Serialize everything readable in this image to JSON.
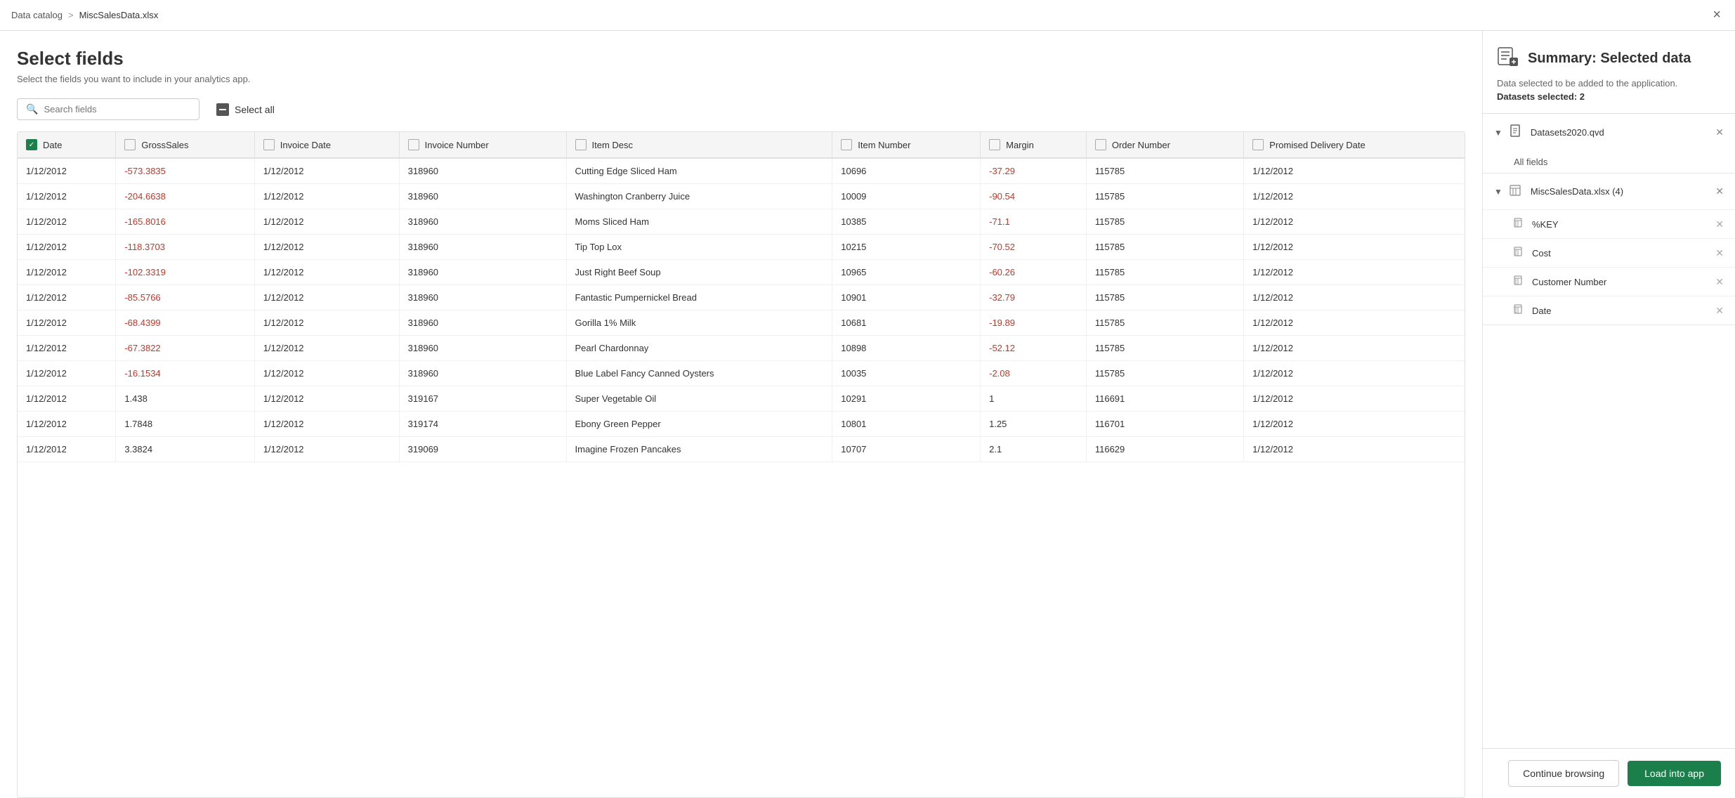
{
  "topbar": {
    "breadcrumb_catalog": "Data catalog",
    "breadcrumb_separator": ">",
    "breadcrumb_file": "MiscSalesData.xlsx",
    "close_label": "×"
  },
  "page": {
    "title": "Select fields",
    "subtitle": "Select the fields you want to include in your analytics app."
  },
  "toolbar": {
    "search_placeholder": "Search fields",
    "select_all_label": "Select all"
  },
  "table": {
    "columns": [
      {
        "id": "date",
        "label": "Date",
        "checked": true
      },
      {
        "id": "grosssales",
        "label": "GrossSales",
        "checked": false
      },
      {
        "id": "invoicedate",
        "label": "Invoice Date",
        "checked": false
      },
      {
        "id": "invoicenumber",
        "label": "Invoice Number",
        "checked": false
      },
      {
        "id": "itemdesc",
        "label": "Item Desc",
        "checked": false
      },
      {
        "id": "itemnumber",
        "label": "Item Number",
        "checked": false
      },
      {
        "id": "margin",
        "label": "Margin",
        "checked": false
      },
      {
        "id": "ordernumber",
        "label": "Order Number",
        "checked": false
      },
      {
        "id": "promiseddeliverydate",
        "label": "Promised Delivery Date",
        "checked": false
      }
    ],
    "rows": [
      {
        "date": "1/12/2012",
        "grosssales": "-573.3835",
        "invoicedate": "1/12/2012",
        "invoicenumber": "318960",
        "itemdesc": "Cutting Edge Sliced Ham",
        "itemnumber": "10696",
        "margin": "-37.29",
        "ordernumber": "115785",
        "promiseddeliverydate": "1/12/2012"
      },
      {
        "date": "1/12/2012",
        "grosssales": "-204.6638",
        "invoicedate": "1/12/2012",
        "invoicenumber": "318960",
        "itemdesc": "Washington Cranberry Juice",
        "itemnumber": "10009",
        "margin": "-90.54",
        "ordernumber": "115785",
        "promiseddeliverydate": "1/12/2012"
      },
      {
        "date": "1/12/2012",
        "grosssales": "-165.8016",
        "invoicedate": "1/12/2012",
        "invoicenumber": "318960",
        "itemdesc": "Moms Sliced Ham",
        "itemnumber": "10385",
        "margin": "-71.1",
        "ordernumber": "115785",
        "promiseddeliverydate": "1/12/2012"
      },
      {
        "date": "1/12/2012",
        "grosssales": "-118.3703",
        "invoicedate": "1/12/2012",
        "invoicenumber": "318960",
        "itemdesc": "Tip Top Lox",
        "itemnumber": "10215",
        "margin": "-70.52",
        "ordernumber": "115785",
        "promiseddeliverydate": "1/12/2012"
      },
      {
        "date": "1/12/2012",
        "grosssales": "-102.3319",
        "invoicedate": "1/12/2012",
        "invoicenumber": "318960",
        "itemdesc": "Just Right Beef Soup",
        "itemnumber": "10965",
        "margin": "-60.26",
        "ordernumber": "115785",
        "promiseddeliverydate": "1/12/2012"
      },
      {
        "date": "1/12/2012",
        "grosssales": "-85.5766",
        "invoicedate": "1/12/2012",
        "invoicenumber": "318960",
        "itemdesc": "Fantastic Pumpernickel Bread",
        "itemnumber": "10901",
        "margin": "-32.79",
        "ordernumber": "115785",
        "promiseddeliverydate": "1/12/2012"
      },
      {
        "date": "1/12/2012",
        "grosssales": "-68.4399",
        "invoicedate": "1/12/2012",
        "invoicenumber": "318960",
        "itemdesc": "Gorilla 1% Milk",
        "itemnumber": "10681",
        "margin": "-19.89",
        "ordernumber": "115785",
        "promiseddeliverydate": "1/12/2012"
      },
      {
        "date": "1/12/2012",
        "grosssales": "-67.3822",
        "invoicedate": "1/12/2012",
        "invoicenumber": "318960",
        "itemdesc": "Pearl Chardonnay",
        "itemnumber": "10898",
        "margin": "-52.12",
        "ordernumber": "115785",
        "promiseddeliverydate": "1/12/2012"
      },
      {
        "date": "1/12/2012",
        "grosssales": "-16.1534",
        "invoicedate": "1/12/2012",
        "invoicenumber": "318960",
        "itemdesc": "Blue Label Fancy Canned Oysters",
        "itemnumber": "10035",
        "margin": "-2.08",
        "ordernumber": "115785",
        "promiseddeliverydate": "1/12/2012"
      },
      {
        "date": "1/12/2012",
        "grosssales": "1.438",
        "invoicedate": "1/12/2012",
        "invoicenumber": "319167",
        "itemdesc": "Super Vegetable Oil",
        "itemnumber": "10291",
        "margin": "1",
        "ordernumber": "116691",
        "promiseddeliverydate": "1/12/2012"
      },
      {
        "date": "1/12/2012",
        "grosssales": "1.7848",
        "invoicedate": "1/12/2012",
        "invoicenumber": "319174",
        "itemdesc": "Ebony Green Pepper",
        "itemnumber": "10801",
        "margin": "1.25",
        "ordernumber": "116701",
        "promiseddeliverydate": "1/12/2012"
      },
      {
        "date": "1/12/2012",
        "grosssales": "3.3824",
        "invoicedate": "1/12/2012",
        "invoicenumber": "319069",
        "itemdesc": "Imagine Frozen Pancakes",
        "itemnumber": "10707",
        "margin": "2.1",
        "ordernumber": "116629",
        "promiseddeliverydate": "1/12/2012"
      }
    ]
  },
  "summary": {
    "title": "Summary: Selected data",
    "subtitle": "Data selected to be added to the application.",
    "datasets_label": "Datasets selected: 2",
    "dataset1": {
      "name": "Datasets2020.qvd",
      "fields_label": "All fields"
    },
    "dataset2": {
      "name": "MiscSalesData.xlsx (4)",
      "fields": [
        {
          "name": "%KEY"
        },
        {
          "name": "Cost"
        },
        {
          "name": "Customer Number"
        },
        {
          "name": "Date"
        }
      ]
    }
  },
  "footer": {
    "continue_label": "Continue browsing",
    "load_label": "Load into app"
  }
}
